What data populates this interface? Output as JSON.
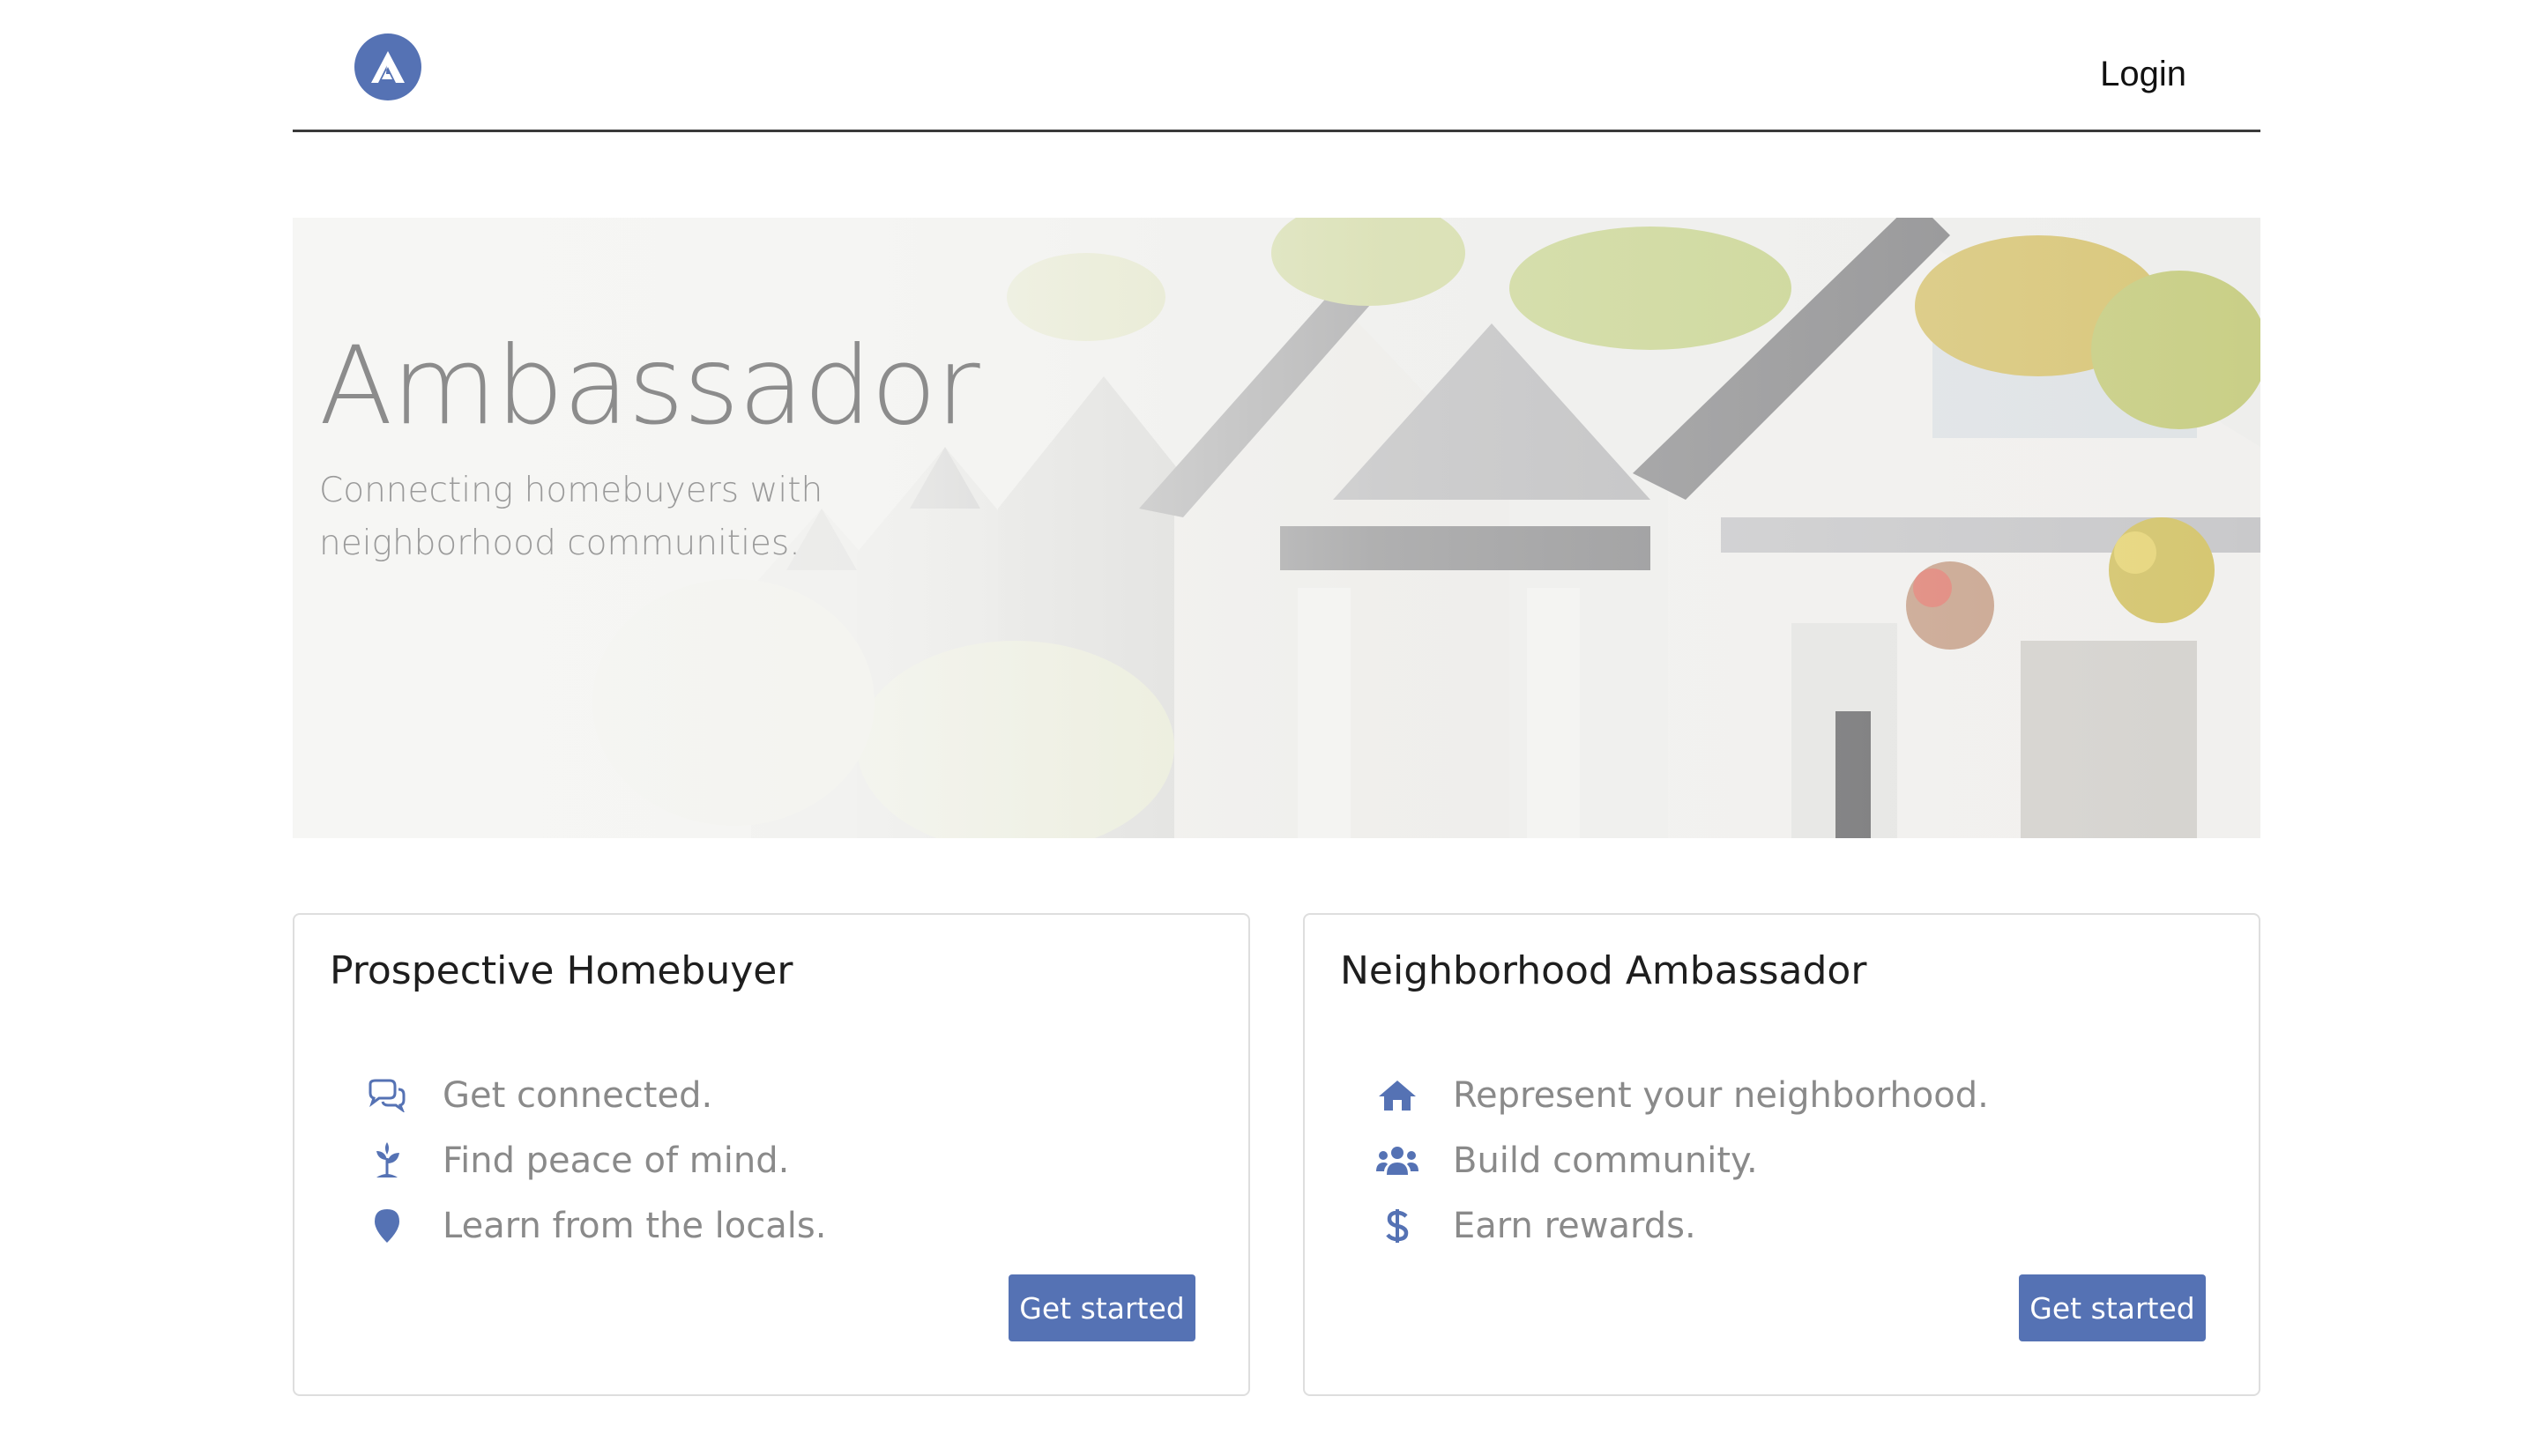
{
  "header": {
    "login_label": "Login"
  },
  "hero": {
    "title": "Ambassador",
    "subtitle": "Connecting homebuyers with neighborhood communities."
  },
  "cards": [
    {
      "title": "Prospective Homebuyer",
      "features": [
        {
          "icon": "chat-bubbles-icon",
          "text": "Get connected."
        },
        {
          "icon": "seedling-icon",
          "text": "Find peace of mind."
        },
        {
          "icon": "map-marker-icon",
          "text": "Learn from the locals."
        }
      ],
      "button_label": "Get started"
    },
    {
      "title": "Neighborhood Ambassador",
      "features": [
        {
          "icon": "home-icon",
          "text": "Represent your neighborhood."
        },
        {
          "icon": "users-icon",
          "text": "Build community."
        },
        {
          "icon": "dollar-icon",
          "text": "Earn rewards."
        }
      ],
      "button_label": "Get started"
    }
  ],
  "colors": {
    "accent": "#5572b4",
    "divider": "#3a3a3a",
    "muted_text": "#8a8a8a"
  }
}
